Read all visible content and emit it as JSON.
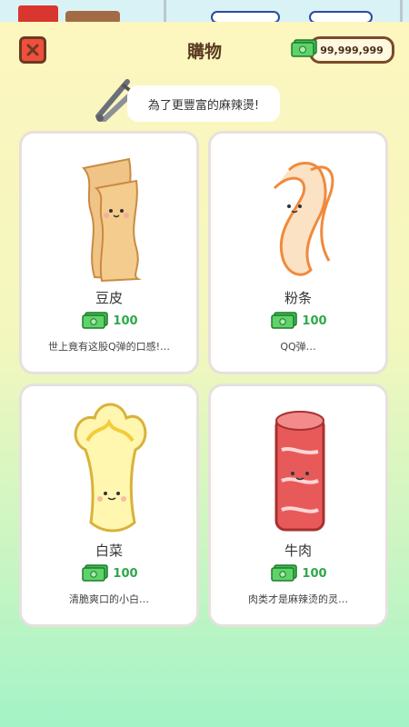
{
  "header": {
    "title": "購物",
    "cash": "99,999,999"
  },
  "banner": {
    "text": "為了更豐富的麻辣燙!"
  },
  "items": [
    {
      "name": "豆皮",
      "price": "100",
      "desc": "世上竟有这股Q弹的口感!…",
      "icon": "tofu-skin-icon"
    },
    {
      "name": "粉条",
      "price": "100",
      "desc": "QQ弹…",
      "icon": "vermicelli-icon"
    },
    {
      "name": "白菜",
      "price": "100",
      "desc": "清脆爽口的小白…",
      "icon": "cabbage-icon"
    },
    {
      "name": "牛肉",
      "price": "100",
      "desc": "肉类才是麻辣烫的灵…",
      "icon": "beef-roll-icon"
    }
  ],
  "colors": {
    "accent_red": "#f04f3e",
    "brown": "#6b3a22",
    "price_green": "#2ea84a"
  }
}
